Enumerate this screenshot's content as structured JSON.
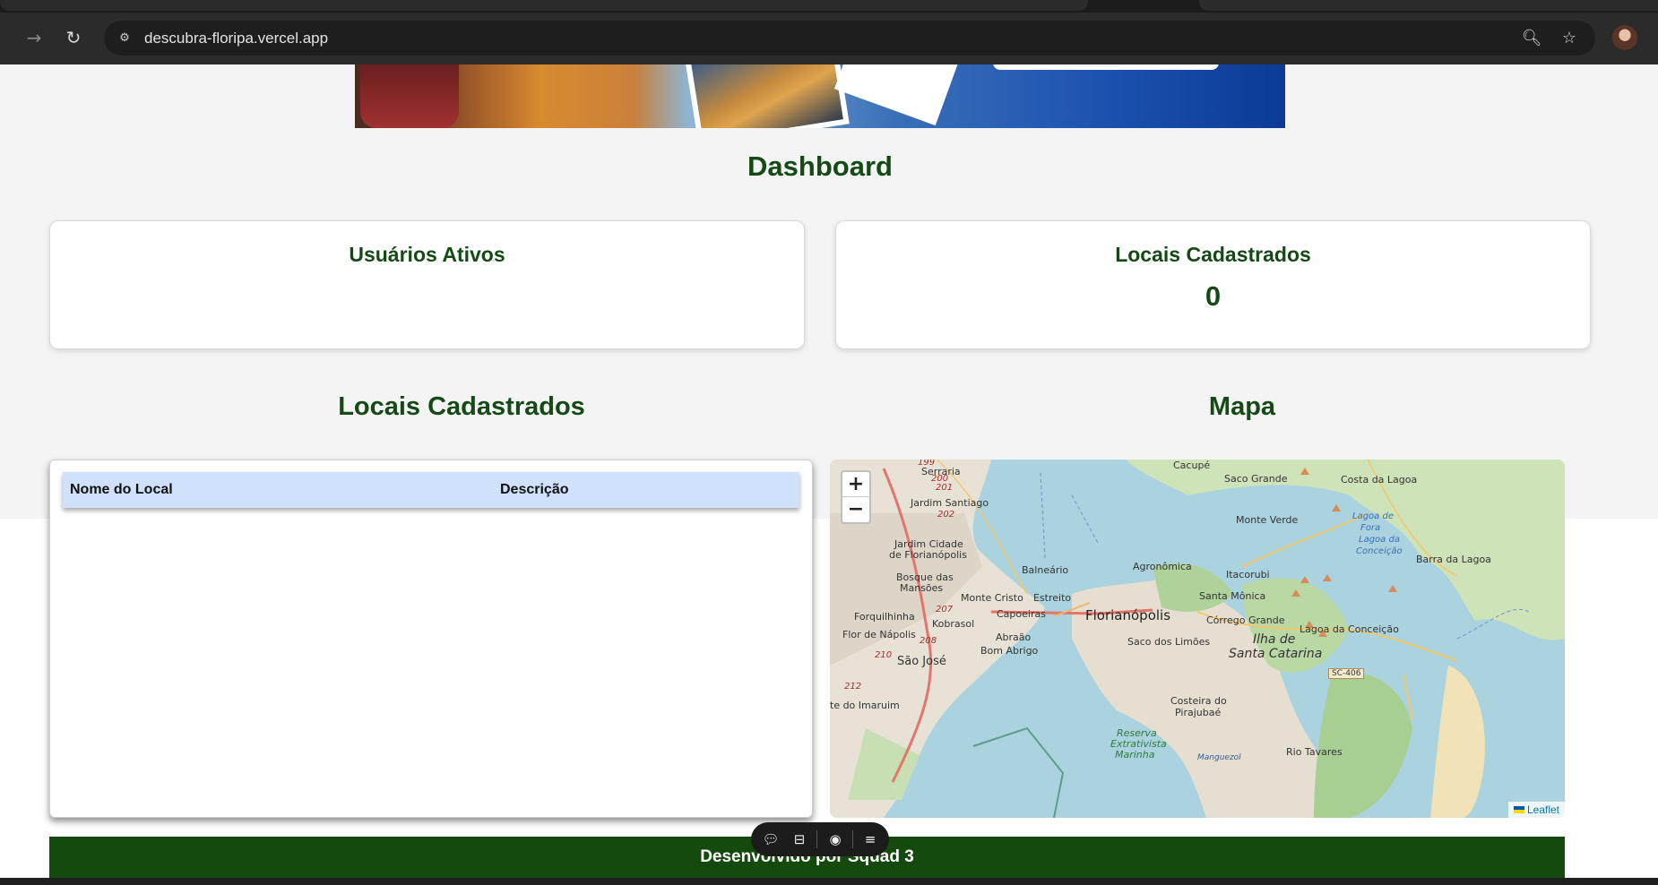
{
  "browser": {
    "url": "descubra-floripa.vercel.app",
    "icons": {
      "forward": "arrow-forward-icon",
      "reload": "reload-icon",
      "site_info": "site-settings-icon",
      "zoom": "zoom-icon",
      "bookmark": "star-icon",
      "profile": "avatar"
    }
  },
  "page": {
    "title": "Dashboard",
    "stats": [
      {
        "label": "Usuários Ativos",
        "value": ""
      },
      {
        "label": "Locais Cadastrados",
        "value": "0"
      }
    ],
    "list_section_title": "Locais Cadastrados",
    "map_section_title": "Mapa",
    "table": {
      "columns": [
        "Nome do Local",
        "Descrição"
      ],
      "rows": []
    },
    "map": {
      "zoom_in": "+",
      "zoom_out": "−",
      "attribution": "Leaflet",
      "labels": {
        "florianopolis": "Florianópolis",
        "ilha": "Ilha de",
        "santa_catarina": "Santa Catarina",
        "sao_jose": "São José",
        "monte_cristo": "Monte Cristo",
        "estreito": "Estreito",
        "capoeiras": "Capoeiras",
        "balneario": "Balneário",
        "agronomica": "Agronômica",
        "itacorubi": "Itacorubi",
        "santa_monica": "Santa Mônica",
        "corrego_grande": "Córrego Grande",
        "lagoa_conceicao": "Lagoa da Conceição",
        "saco_limoes": "Saco dos Limões",
        "costeira": "Costeira do",
        "pirajubae": "Pirajubaé",
        "saco_grande": "Saco Grande",
        "costa_lagoa": "Costa da Lagoa",
        "monte_verde": "Monte Verde",
        "cacupe": "Cacupé",
        "serraria": "Serraria",
        "jardim_santiago": "Jardim Santiago",
        "jardim_cidade": "Jardim Cidade",
        "de_florianopolis": "de Florianópolis",
        "bosque": "Bosque das",
        "mansoes": "Mansões",
        "forquilhinha": "Forquilhinha",
        "kobrasol": "Kobrasol",
        "flor_napolis": "Flor de Nápolis",
        "abraao": "Abraão",
        "bom_abrigo": "Bom Abrigo",
        "barra_lagoa": "Barra da Lagoa",
        "rio_tavares": "Rio Tavares",
        "sc406": "SC-406",
        "reserva": "Reserva",
        "extrativista": "Extrativista",
        "marinha": "Marinha",
        "mangue": "Manguezol",
        "imaruim": "te do Imaruim",
        "lagoa_fora": "Lagoa de",
        "fora": "Fora",
        "lagoa_da": "Lagoa da",
        "conceicao": "Conceição",
        "r199": "199",
        "r200": "200",
        "r201": "201",
        "r202": "202",
        "r207": "207",
        "r208": "208",
        "r210": "210",
        "r212": "212"
      }
    },
    "footer": "Desenvolvido por Squad 3"
  },
  "floating_toolbar": {
    "icons": [
      "comment-icon",
      "inbox-icon",
      "eye-toggle-icon",
      "menu-icon"
    ]
  }
}
